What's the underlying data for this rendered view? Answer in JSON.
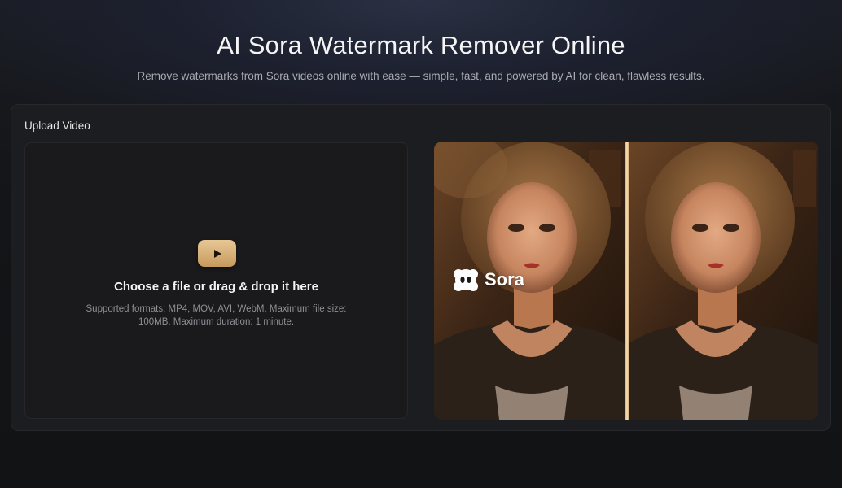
{
  "hero": {
    "title": "AI Sora Watermark Remover Online",
    "subtitle": "Remove watermarks from Sora videos online with ease — simple, fast, and powered by AI for clean, flawless results."
  },
  "upload": {
    "label": "Upload Video",
    "drop_title": "Choose a file or drag & drop it here",
    "drop_hint": "Supported formats: MP4, MOV, AVI, WebM. Maximum file size: 100MB. Maximum duration: 1 minute.",
    "icon": "play-icon"
  },
  "preview": {
    "watermark_text": "Sora",
    "watermark_icon": "sora-logo-icon",
    "divider": "comparison-slider"
  },
  "colors": {
    "accent": "#d8b07a",
    "background": "#141518",
    "panel": "#1c1d20"
  }
}
